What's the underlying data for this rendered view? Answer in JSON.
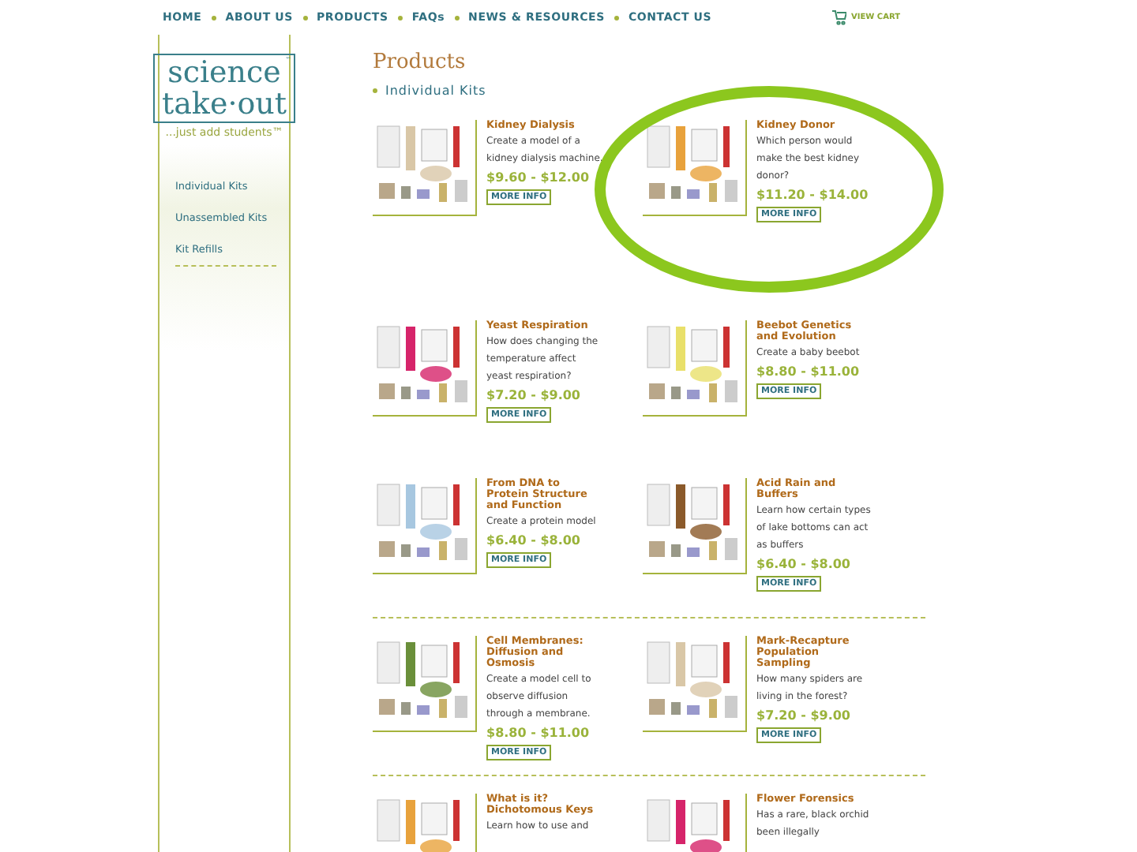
{
  "nav": {
    "items": [
      "HOME",
      "ABOUT US",
      "PRODUCTS",
      "FAQs",
      "NEWS & RESOURCES",
      "CONTACT US"
    ],
    "cart": "VIEW CART"
  },
  "logo": {
    "line1": "science",
    "line2": "take·out",
    "tagline": "...just add students",
    "tm": "™"
  },
  "sidebar": {
    "items": [
      "Individual Kits",
      "Unassembled Kits",
      "Kit Refills"
    ]
  },
  "page_title": "Products",
  "section": "Individual Kits",
  "rows": [
    {
      "divider_above": false,
      "products": [
        {
          "name": "Kidney Dialysis",
          "description": "Create a model of a kidney dialysis machine.",
          "price": "$9.60 - $12.00",
          "button": "MORE INFO"
        },
        {
          "name": "Kidney Donor",
          "description": "Which person would make the best kidney donor?",
          "price": "$11.20 - $14.00",
          "button": "MORE INFO"
        }
      ]
    },
    {
      "divider_above": false,
      "products": [
        {
          "name": "Yeast Respiration",
          "description": "How does changing the temperature affect yeast respiration?",
          "price": "$7.20 - $9.00",
          "button": "MORE INFO"
        },
        {
          "name": "Beebot Genetics and Evolution",
          "description": "Create a baby beebot",
          "price": "$8.80 - $11.00",
          "button": "MORE INFO"
        }
      ]
    },
    {
      "divider_above": false,
      "products": [
        {
          "name": "From DNA to Protein Structure and Function",
          "description": "Create a protein model",
          "price": "$6.40 - $8.00",
          "button": "MORE INFO"
        },
        {
          "name": "Acid Rain and Buffers",
          "description": "Learn how certain types of lake bottoms can act as buffers",
          "price": "$6.40 - $8.00",
          "button": "MORE INFO"
        }
      ]
    },
    {
      "divider_above": true,
      "products": [
        {
          "name": "Cell Membranes: Diffusion and Osmosis",
          "description": "Create a model cell to observe diffusion through a membrane.",
          "price": "$8.80 - $11.00",
          "button": "MORE INFO"
        },
        {
          "name": "Mark-Recapture Population Sampling",
          "description": "How many spiders are living in the forest?",
          "price": "$7.20 - $9.00",
          "button": "MORE INFO"
        }
      ]
    },
    {
      "divider_above": true,
      "products": [
        {
          "name": "What is it? Dichotomous Keys",
          "description": "Learn how to use and"
        },
        {
          "name": "Flower Forensics",
          "description": "Has a rare, black orchid been illegally"
        }
      ]
    }
  ],
  "annotation": {
    "kind": "ellipse",
    "color": "#8cc71e"
  }
}
